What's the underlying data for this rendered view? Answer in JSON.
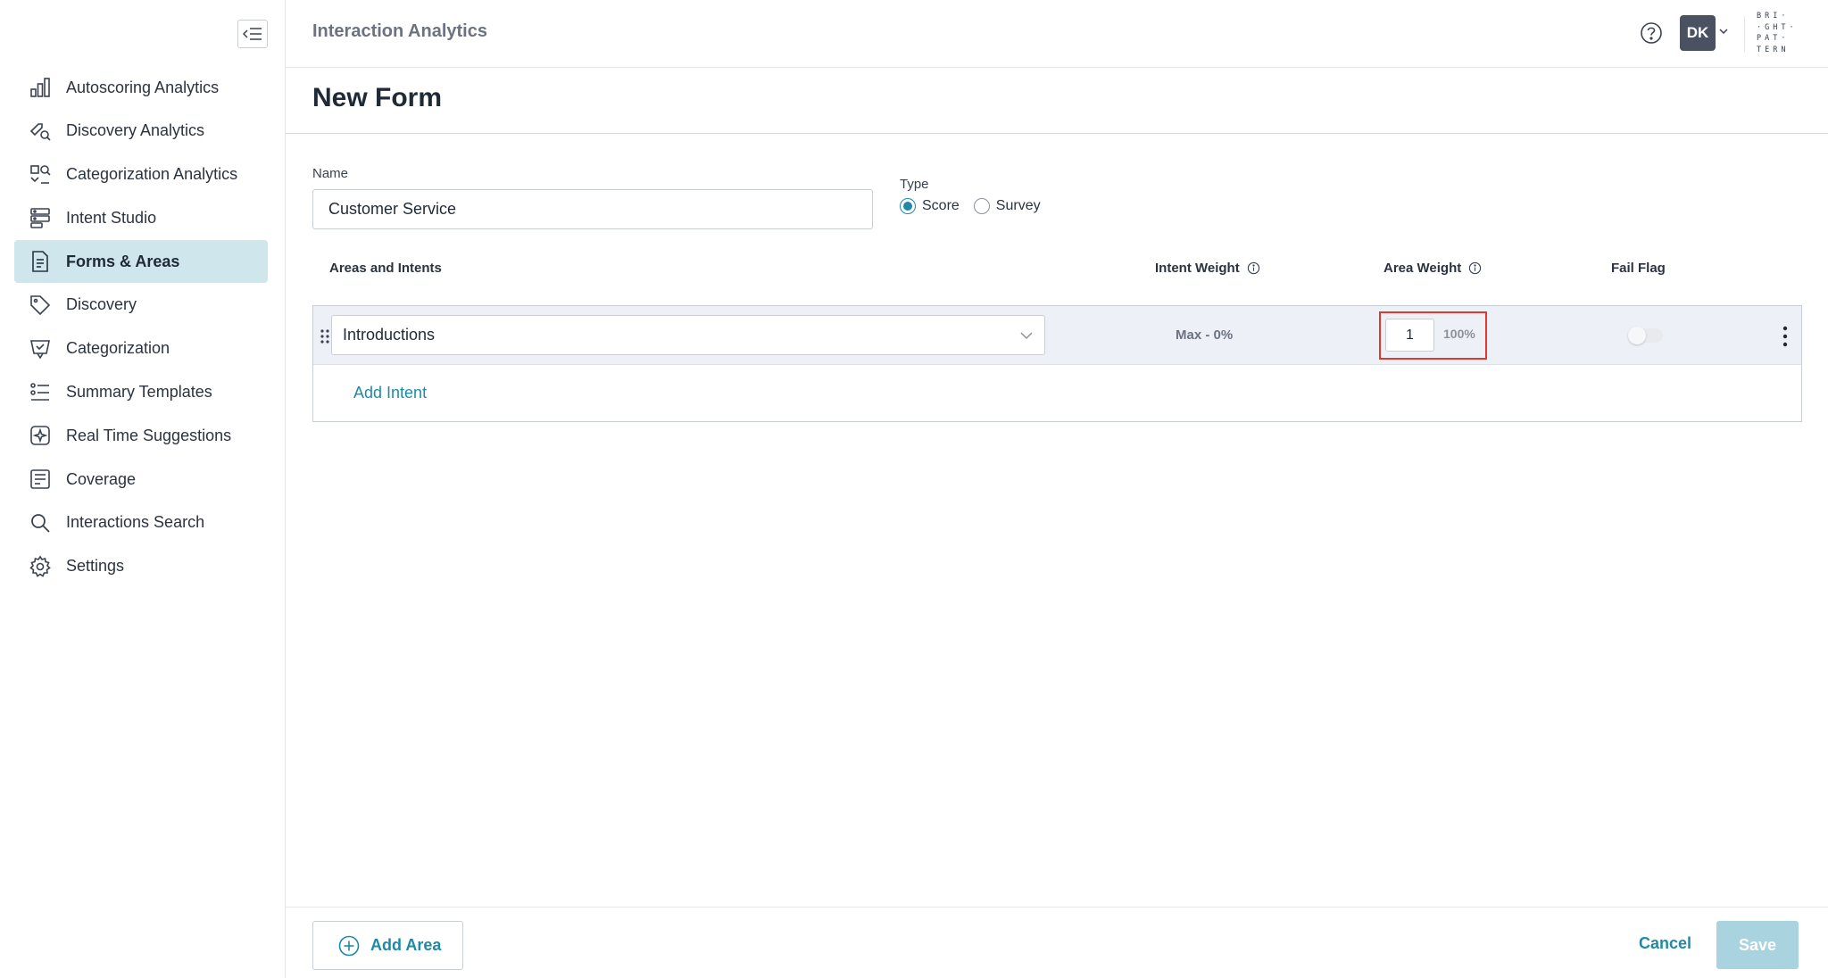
{
  "header": {
    "title": "Interaction Analytics",
    "avatar_initials": "DK",
    "logo_lines": [
      "BRI·",
      "·GHT·",
      "PAT·",
      "TERN"
    ],
    "help_icon": "help-circle-icon"
  },
  "sidebar": {
    "collapse_icon": "collapse-sidebar-icon",
    "active_color": "#cfe6ed",
    "items": [
      {
        "label": "Autoscoring Analytics",
        "icon": "bar-chart-icon"
      },
      {
        "label": "Discovery Analytics",
        "icon": "tag-search-icon"
      },
      {
        "label": "Categorization Analytics",
        "icon": "category-search-icon"
      },
      {
        "label": "Intent Studio",
        "icon": "intent-studio-icon"
      },
      {
        "label": "Forms & Areas",
        "icon": "form-document-icon",
        "active": true
      },
      {
        "label": "Discovery",
        "icon": "tag-icon"
      },
      {
        "label": "Categorization",
        "icon": "category-icon"
      },
      {
        "label": "Summary Templates",
        "icon": "list-template-icon"
      },
      {
        "label": "Real Time Suggestions",
        "icon": "sparkle-icon"
      },
      {
        "label": "Coverage",
        "icon": "coverage-icon"
      },
      {
        "label": "Interactions Search",
        "icon": "search-icon"
      },
      {
        "label": "Settings",
        "icon": "gear-icon"
      }
    ]
  },
  "page": {
    "title": "New Form"
  },
  "form": {
    "name_label": "Name",
    "name_value": "Customer Service",
    "type_label": "Type",
    "type_options": [
      {
        "label": "Score",
        "checked": true
      },
      {
        "label": "Survey",
        "checked": false
      }
    ]
  },
  "table": {
    "col_areas": "Areas and Intents",
    "col_intent_weight": "Intent Weight",
    "col_area_weight": "Area Weight",
    "col_fail_flag": "Fail Flag"
  },
  "area": {
    "selected": "Introductions",
    "intent_weight_text": "Max - 0%",
    "area_weight_value": "1",
    "area_weight_percent": "100%",
    "fail_flag_on": false,
    "add_intent_label": "Add Intent"
  },
  "footer": {
    "add_area_label": "Add Area",
    "cancel_label": "Cancel",
    "save_label": "Save"
  },
  "colors": {
    "accent": "#1f8aa6",
    "highlight_border": "#e03a2c",
    "save_disabled": "#a9d3de"
  }
}
